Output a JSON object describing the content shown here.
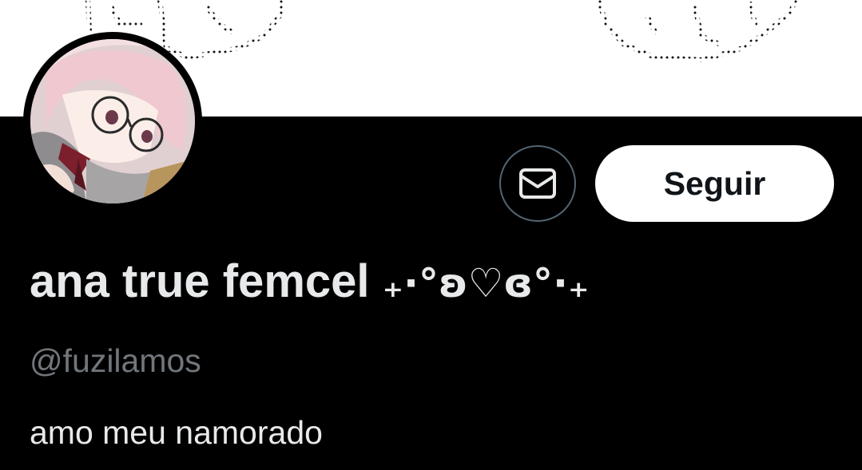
{
  "profile": {
    "display_name": "ana true femcel",
    "display_name_decoration": "₊·°ʚ♡ɞ°·₊",
    "handle": "@fuzilamos",
    "bio": "amo meu namorado"
  },
  "actions": {
    "follow_label": "Seguir",
    "message_icon": "mail-icon"
  },
  "colors": {
    "background": "#000000",
    "banner": "#ffffff",
    "primary_text": "#e7e9ea",
    "secondary_text": "#71767b",
    "button_border": "#536471",
    "follow_bg": "#ffffff",
    "follow_text": "#0f1419"
  }
}
